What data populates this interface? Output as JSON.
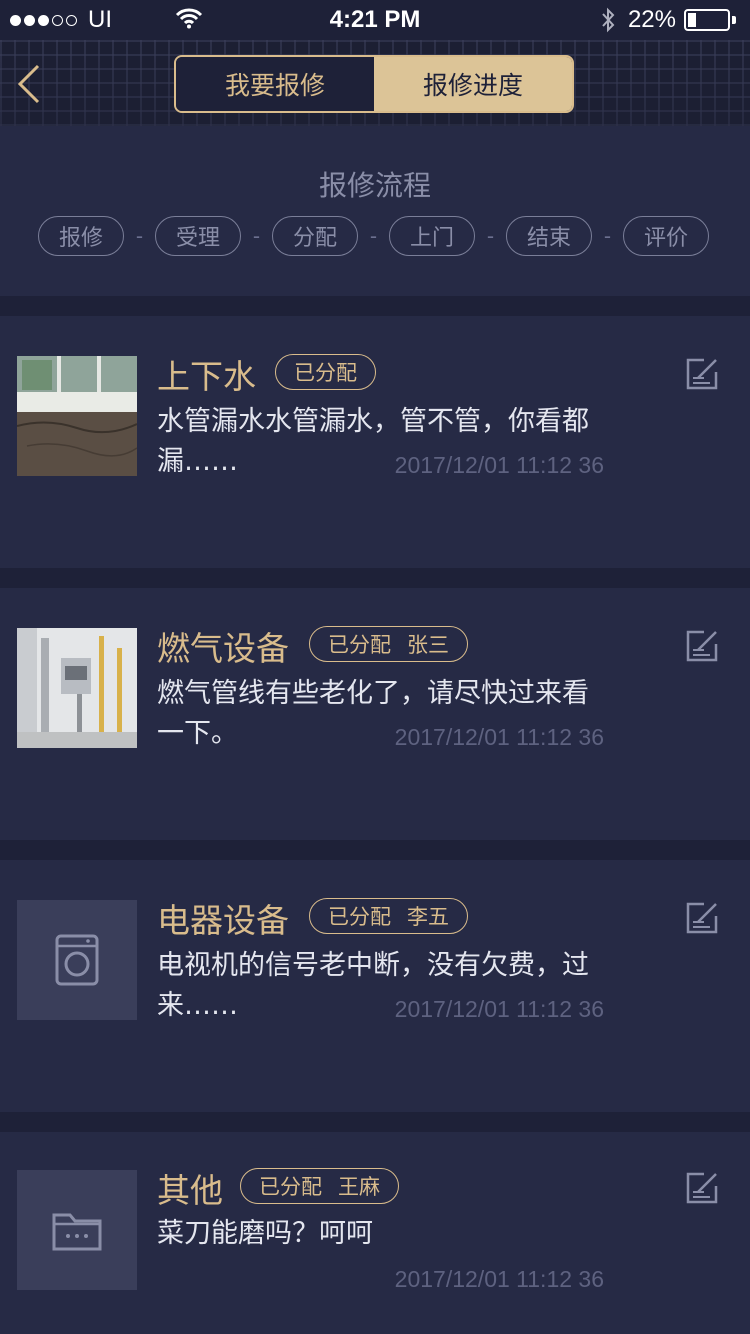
{
  "status_bar": {
    "carrier": "UI",
    "time": "4:21 PM",
    "battery": "22%",
    "battery_level": 0.22
  },
  "nav": {
    "tabs": [
      {
        "label": "我要报修",
        "active": false
      },
      {
        "label": "报修进度",
        "active": true
      }
    ]
  },
  "process": {
    "title": "报修流程",
    "steps": [
      "报修",
      "受理",
      "分配",
      "上门",
      "结束",
      "评价"
    ],
    "separator": "-"
  },
  "repairs": [
    {
      "category": "上下水",
      "status": "已分配",
      "assignee": "",
      "description": "水管漏水水管漏水，管不管，你看都漏……",
      "time": "2017/12/01 11:12 36",
      "thumbnail": "photo-window-sill"
    },
    {
      "category": "燃气设备",
      "status": "已分配",
      "assignee": "张三",
      "description": "燃气管线有些老化了，请尽快过来看一下。",
      "time": "2017/12/01 11:12 36",
      "thumbnail": "photo-gas-meter"
    },
    {
      "category": "电器设备",
      "status": "已分配",
      "assignee": "李五",
      "description": "电视机的信号老中断，没有欠费，过来……",
      "time": "2017/12/01 11:12 36",
      "thumbnail": "washing-machine-icon"
    },
    {
      "category": "其他",
      "status": "已分配",
      "assignee": "王麻",
      "description": "菜刀能磨吗？呵呵",
      "time": "2017/12/01 11:12 36",
      "thumbnail": "folder-icon"
    }
  ],
  "colors": {
    "background": "#1e2138",
    "card": "#262a45",
    "accent": "#d9bc8c",
    "muted": "#8a8ea8"
  }
}
